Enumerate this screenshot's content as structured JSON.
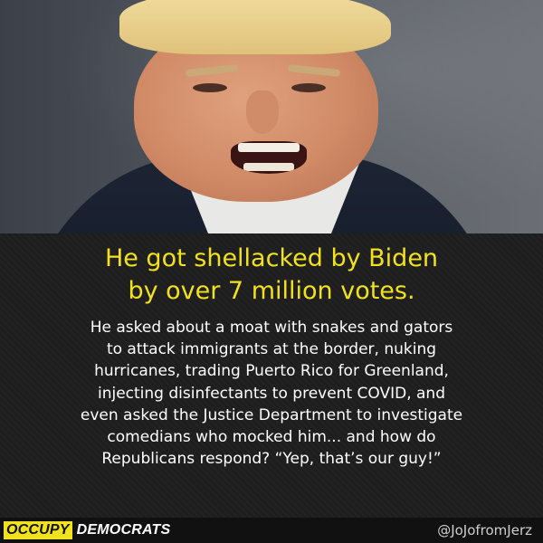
{
  "headline": {
    "lines": [
      "He got shellacked by Biden",
      "by over 7 million votes."
    ],
    "color": "#f2e21e"
  },
  "body": {
    "lines": [
      "He asked about a moat with snakes and gators",
      "to attack immigrants at the border, nuking",
      "hurricanes, trading Puerto Rico for Greenland,",
      "injecting disinfectants to prevent COVID, and",
      "even asked the Justice Department to investigate",
      "comedians who mocked him... and how do",
      "Republicans respond? “Yep, that’s our guy!”"
    ],
    "color": "#ffffff"
  },
  "footer": {
    "logo_part1": "OCCUPY",
    "logo_part2": "DEMOCRATS",
    "handle": "@JoJofromJerz",
    "accent_color": "#f2e21e"
  }
}
